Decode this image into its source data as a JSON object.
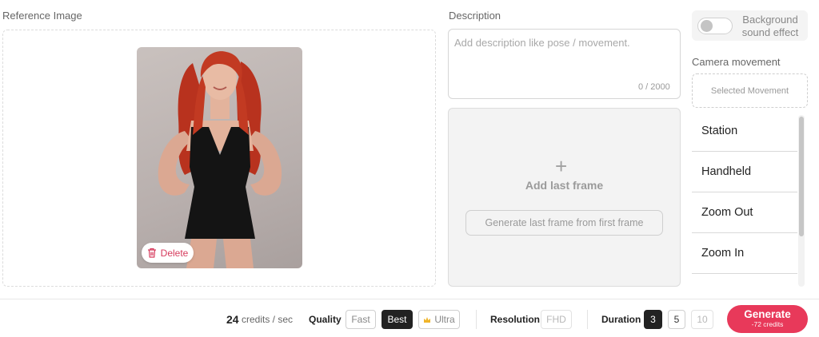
{
  "reference": {
    "label": "Reference Image",
    "delete_label": "Delete"
  },
  "description": {
    "label": "Description",
    "placeholder": "Add description like pose / movement.",
    "counter": "0 / 2000"
  },
  "last_frame": {
    "add_label": "Add last frame",
    "generate_button": "Generate last frame from first frame"
  },
  "background_sound": {
    "label_line1": "Background",
    "label_line2": "sound effect",
    "enabled": false
  },
  "camera": {
    "label": "Camera movement",
    "selected_placeholder": "Selected Movement",
    "items": [
      "Station",
      "Handheld",
      "Zoom Out",
      "Zoom In"
    ]
  },
  "footer": {
    "credits_value": "24",
    "credits_unit": "credits / sec",
    "quality_label": "Quality",
    "quality_options": [
      "Fast",
      "Best",
      "Ultra"
    ],
    "quality_selected": "Best",
    "resolution_label": "Resolution",
    "resolution_value": "FHD",
    "duration_label": "Duration",
    "duration_options": [
      "3",
      "5",
      "10"
    ],
    "duration_selected": "3",
    "generate_label": "Generate",
    "generate_cost": "-72 credits"
  },
  "colors": {
    "accent": "#e8395a",
    "dark": "#222222",
    "ultra_icon": "#f0b429"
  }
}
